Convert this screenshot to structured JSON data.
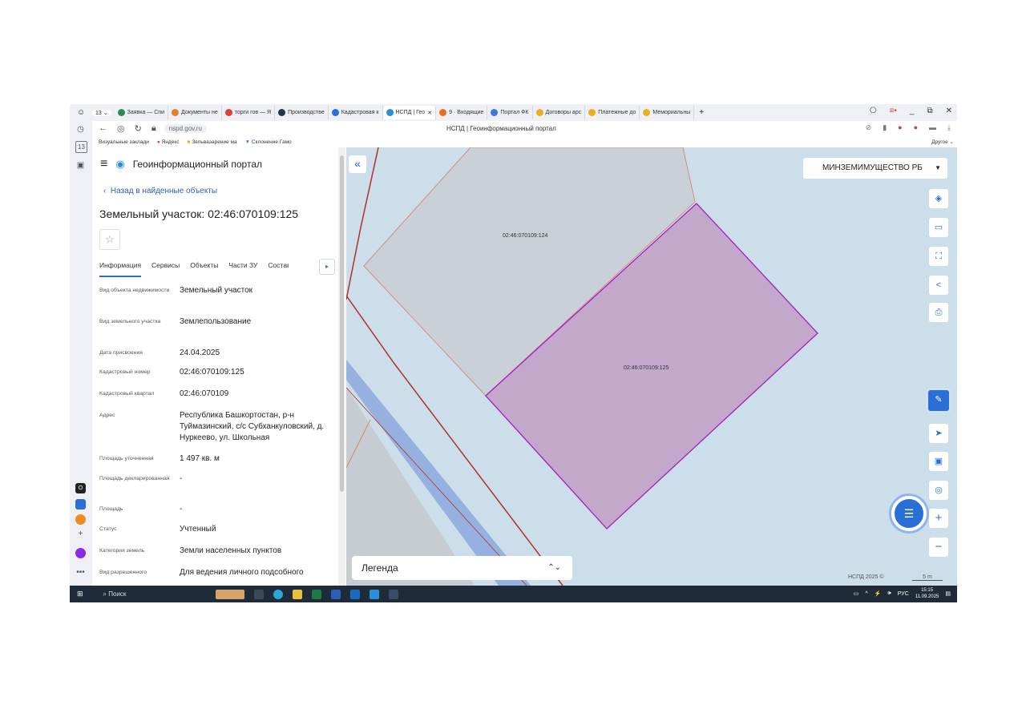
{
  "browser": {
    "tabs": [
      {
        "label": "Заявка — Спи",
        "color": "#2e8b57"
      },
      {
        "label": "Документы не",
        "color": "#e0822a"
      },
      {
        "label": "торги гов — Я",
        "color": "#e04030"
      },
      {
        "label": "Производстве",
        "color": "#223344"
      },
      {
        "label": "Кадастровая к",
        "color": "#2a6fd6"
      },
      {
        "label": "НСПД | Гео",
        "color": "#2a8fd6",
        "active": true
      },
      {
        "label": "9 · Входящие",
        "color": "#e07020"
      },
      {
        "label": "Портал ФК",
        "color": "#3a7bd5"
      },
      {
        "label": "Договоры арс",
        "color": "#e8b020"
      },
      {
        "label": "Платежные до",
        "color": "#e8b020"
      },
      {
        "label": "Мемориальны",
        "color": "#e8b020"
      }
    ],
    "new_tab": "+",
    "url": "nspd.gov.ru",
    "page_title": "НСПД | Геоинформационный портал",
    "bookmarks": [
      "Визуальные заклади",
      "Яндекс",
      "Зельваэарение ма",
      "Склонение Гамо"
    ],
    "bookmarks_other": "Другое"
  },
  "panel": {
    "portal_title": "Геоинформационный портал",
    "back_label": "Назад в найденные объекты",
    "object_title": "Земельный участок: 02:46:070109:125",
    "tabs": [
      "Информация",
      "Сервисы",
      "Объекты",
      "Части ЗУ",
      "Состав"
    ],
    "rows": [
      {
        "k": "Вид объекта недвижимости",
        "v": "Земельный участок"
      },
      {
        "k": "Вид земельного участка",
        "v": "Землепользование"
      },
      {
        "k": "Дата присвоения",
        "v": "24.04.2025"
      },
      {
        "k": "Кадастровый номер",
        "v": "02:46:070109:125"
      },
      {
        "k": "Кадастровый квартал",
        "v": "02:46:070109"
      },
      {
        "k": "Адрес",
        "v": "Республика Башкортостан, р-н Туймазинский, с/с Субханкуловский, д. Нуркеево, ул. Школьная"
      },
      {
        "k": "Площадь уточненная",
        "v": "1 497 кв. м"
      },
      {
        "k": "Площадь декларированная",
        "v": "-"
      },
      {
        "k": "Площадь",
        "v": "-"
      },
      {
        "k": "Статус",
        "v": "Учтенный"
      },
      {
        "k": "Категория земель",
        "v": "Земли населенных пунктов"
      },
      {
        "k": "Вид разрешенного",
        "v": "Для ведения личного подсобного"
      }
    ]
  },
  "map": {
    "layer": "МИНЗЕМИМУЩЕСТВО РБ",
    "parcel_124": "02:46:070109:124",
    "parcel_125": "02:46:070109:125",
    "legend": "Легенда",
    "copyright": "НСПД 2025 ©",
    "scale": "5 m",
    "colors": {
      "selected_fill": "#c3a8cc",
      "selected_stroke": "#a020c0",
      "parcel_fill": "#c9d0d8",
      "road": "#8da9dd"
    }
  },
  "taskbar": {
    "search": "Поиск",
    "lang": "РУС",
    "time": "15:15",
    "date": "11.09.2025"
  }
}
